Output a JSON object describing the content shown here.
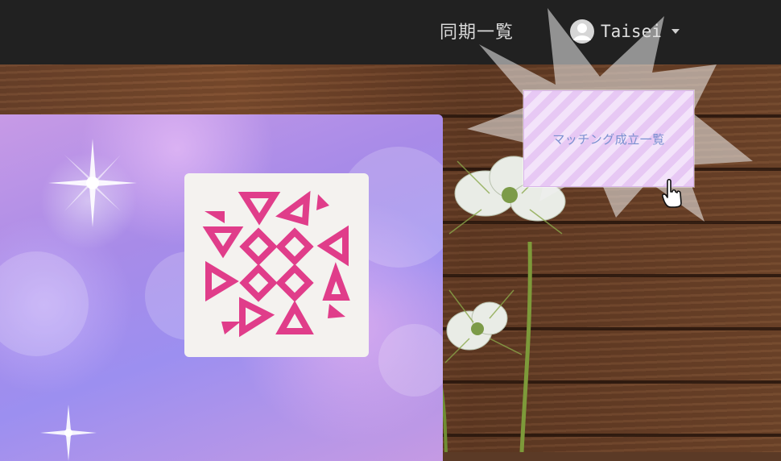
{
  "topbar": {
    "nav_link": "同期一覧",
    "user_name": "Taisei"
  },
  "dropdown": {
    "items": [
      {
        "label": "マッチング成立一覧"
      }
    ]
  },
  "colors": {
    "topbar_bg": "#212121",
    "logo_accent": "#e03d8a",
    "menu_text": "#7a8fd0",
    "menu_stripe": "#e7c8f4"
  },
  "icons": {
    "avatar": "user-avatar-icon",
    "caret": "caret-down-icon",
    "cursor": "hand-pointer-icon",
    "logo": "triangle-diamond-logo"
  }
}
